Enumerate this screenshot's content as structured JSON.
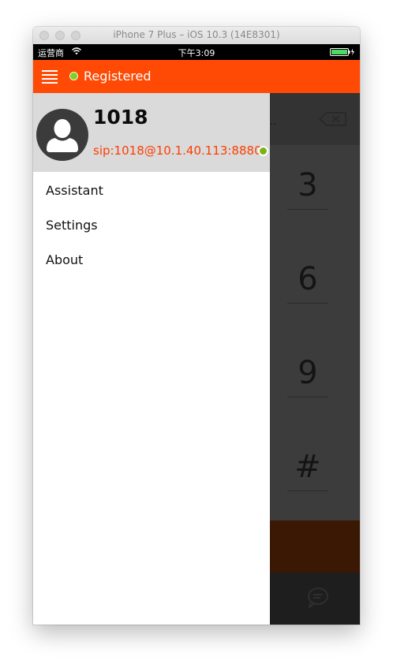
{
  "window": {
    "title": "iPhone 7 Plus – iOS 10.3 (14E8301)"
  },
  "status_bar": {
    "carrier": "运营商",
    "time": "下午3:09",
    "wifi_icon": "wifi-icon",
    "battery_icon": "battery-icon"
  },
  "header": {
    "menu_icon": "hamburger-menu-icon",
    "status_label": "Registered",
    "status_color": "#7ed321",
    "background": "#ff4a06"
  },
  "drawer": {
    "profile": {
      "number": "1018",
      "sip_address": "sip:1018@10.1.40.113:8880",
      "presence_color": "#7ab317"
    },
    "menu": [
      {
        "label": "Assistant"
      },
      {
        "label": "Settings"
      },
      {
        "label": "About"
      }
    ]
  },
  "dialer": {
    "dots": "..",
    "digits": [
      "3",
      "6",
      "9",
      "#"
    ]
  }
}
